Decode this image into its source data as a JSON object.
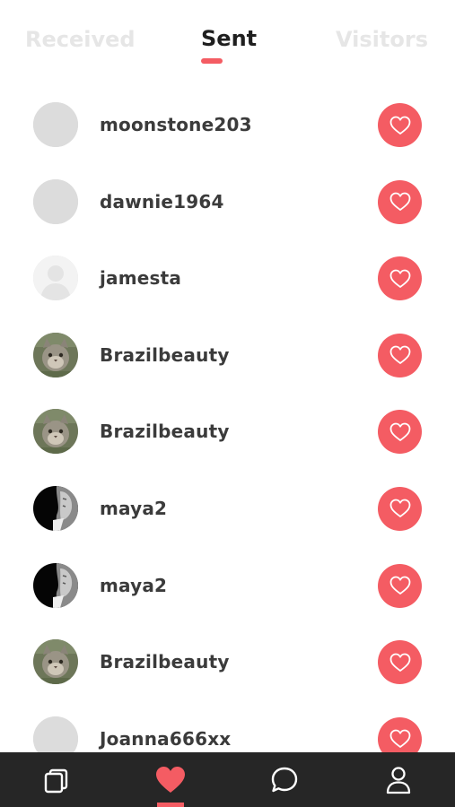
{
  "tabs": {
    "received": "Received",
    "sent": "Sent",
    "visitors": "Visitors",
    "active": "sent"
  },
  "colors": {
    "accent": "#f45c63",
    "tab_inactive": "#e6e6e6",
    "tab_active": "#1f1f1f",
    "username_text": "#3b3b3b",
    "nav_background": "#262626",
    "placeholder_avatar": "#dcdcdc"
  },
  "likes": [
    {
      "username": "moonstone203",
      "avatar": "placeholder-gray"
    },
    {
      "username": "dawnie1964",
      "avatar": "placeholder-gray"
    },
    {
      "username": "jamesta",
      "avatar": "placeholder-silhouette"
    },
    {
      "username": "Brazilbeauty",
      "avatar": "cat-photo"
    },
    {
      "username": "Brazilbeauty",
      "avatar": "cat-photo"
    },
    {
      "username": "maya2",
      "avatar": "bw-portrait-photo"
    },
    {
      "username": "maya2",
      "avatar": "bw-portrait-photo"
    },
    {
      "username": "Brazilbeauty",
      "avatar": "cat-photo"
    },
    {
      "username": "Joanna666xx",
      "avatar": "placeholder-gray"
    }
  ],
  "like_button_icon": "heart-outline-icon",
  "bottom_nav": [
    {
      "name": "cards",
      "icon": "cards-stack-icon",
      "active": false
    },
    {
      "name": "likes",
      "icon": "heart-filled-icon",
      "active": true
    },
    {
      "name": "chat",
      "icon": "chat-bubble-icon",
      "active": false
    },
    {
      "name": "profile",
      "icon": "person-icon",
      "active": false
    }
  ]
}
